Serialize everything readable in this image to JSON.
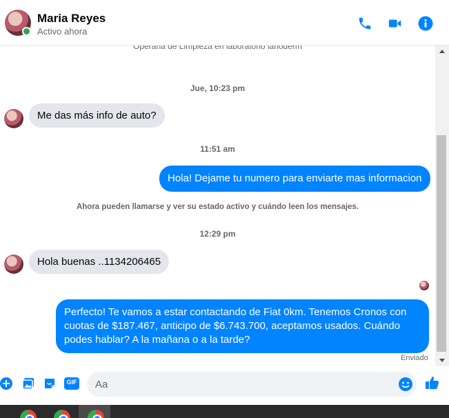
{
  "header": {
    "name": "Maria Reyes",
    "status": "Activo ahora",
    "icons": [
      "phone-icon",
      "video-icon",
      "info-icon"
    ]
  },
  "conversation": {
    "top_system_text": "Operaria de Limpieza en laboratorio lanoderm",
    "timestamp_1": "Jue, 10:23 pm",
    "msg_in_1": "Me das más info de auto?",
    "timestamp_2": "11:51 am",
    "msg_out_1": "Hola! Dejame tu numero para enviarte mas informacion",
    "system_notice": "Ahora pueden llamarse y ver su estado activo y cuándo leen los mensajes.",
    "timestamp_3": "12:29 pm",
    "msg_in_2": "Hola buenas ..1134206465",
    "msg_out_2": "Perfecto! Te vamos a estar contactando de Fiat 0km. Tenemos Cronos con cuotas de $187.467, anticipo de $6.743.700, aceptamos usados. Cuándo podes hablar? A la mañana o a la tarde?",
    "sent_label": "Enviado"
  },
  "composer": {
    "placeholder": "Aa",
    "gif_label": "GIF",
    "icons": [
      "plus-icon",
      "image-icon",
      "sticker-icon",
      "gif-icon",
      "emoji-icon",
      "like-icon"
    ]
  },
  "colors": {
    "accent": "#0084ff",
    "incoming_bubble": "#e4e6eb",
    "online": "#31a24c"
  }
}
